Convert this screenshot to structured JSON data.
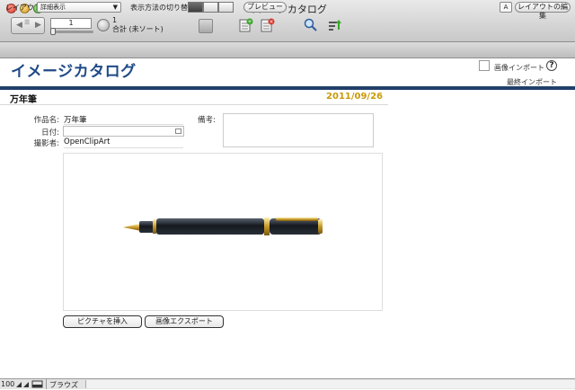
{
  "window": {
    "title": "イメージカタログ"
  },
  "toolbar": {
    "record_field_value": "1",
    "record_count": "1",
    "record_summary": "合計 (未ソート)"
  },
  "layoutbar": {
    "layout_label": "レイアウト:",
    "layout_value": "詳細表示",
    "view_switch_label": "表示方法の切り替え:",
    "preview_label": "プレビュー",
    "font_btn_label": "A",
    "edit_layout_label": "レイアウトの編集"
  },
  "header": {
    "app_title": "イメージカタログ",
    "import_label": "画像インポート",
    "help_glyph": "?",
    "last_import_label": "最終インポート"
  },
  "record": {
    "title": "万年筆",
    "date": "2011/09/26",
    "fields": {
      "title_label": "作品名:",
      "title_value": "万年筆",
      "date_label": "日付:",
      "date_value": "",
      "photographer_label": "撮影者:",
      "photographer_value": "OpenClipArt",
      "notes_label": "備考:"
    },
    "buttons": {
      "insert_picture": "ピクチャを挿入",
      "export_image": "画像エクスポート"
    }
  },
  "status": {
    "zoom": "100",
    "mode": "ブラウズ"
  },
  "colors": {
    "accent_blue": "#1f4a86",
    "date_gold": "#c99a08",
    "header_rule": "#213f68"
  }
}
